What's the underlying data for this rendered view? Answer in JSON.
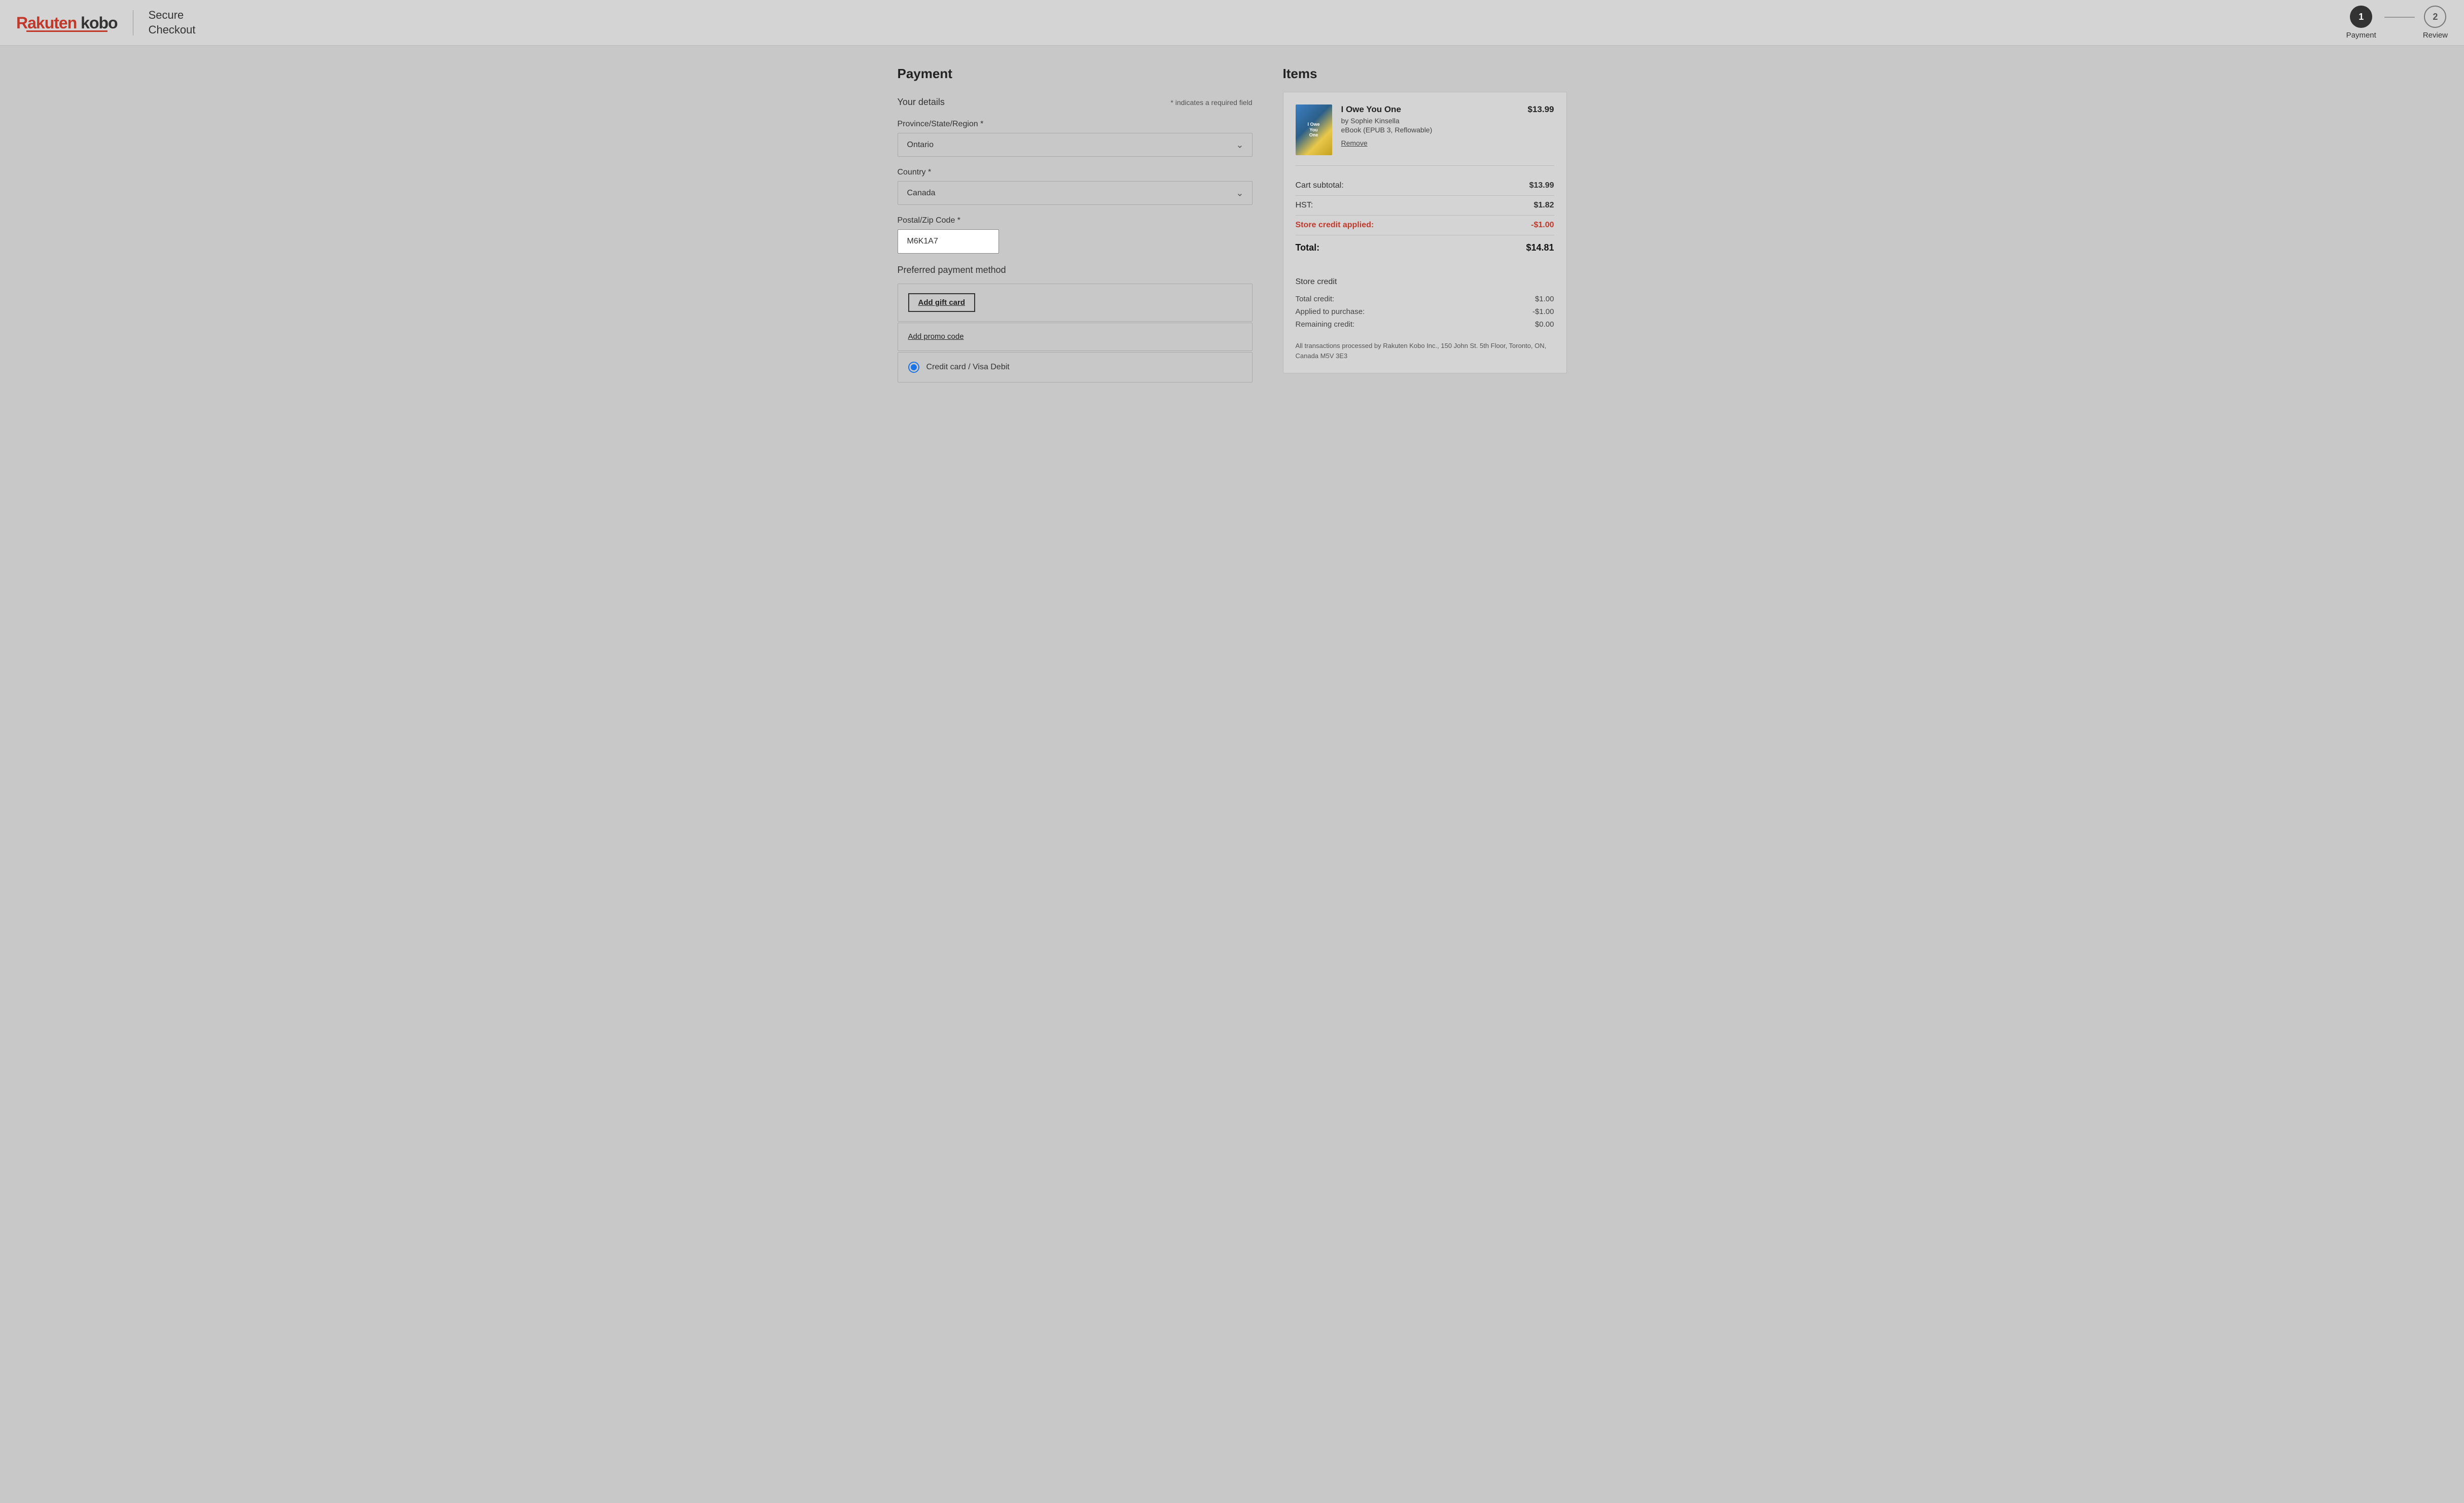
{
  "header": {
    "logo_rakuten": "Rakuten",
    "logo_kobo": " kobo",
    "divider": true,
    "secure_checkout_line1": "Secure",
    "secure_checkout_line2": "Checkout",
    "steps": [
      {
        "number": "1",
        "label": "Payment",
        "active": true
      },
      {
        "number": "2",
        "label": "Review",
        "active": false
      }
    ]
  },
  "payment": {
    "section_title": "Payment",
    "your_details_label": "Your details",
    "required_note": "* indicates a required field",
    "province_label": "Province/State/Region *",
    "province_value": "Ontario",
    "country_label": "Country *",
    "country_value": "Canada",
    "postal_label": "Postal/Zip Code *",
    "postal_value": "M6K1A7",
    "preferred_payment_title": "Preferred payment method",
    "add_gift_card_label": "Add gift card",
    "add_promo_label": "Add promo code",
    "credit_card_label": "Credit card / Visa Debit"
  },
  "items": {
    "section_title": "Items",
    "book": {
      "title": "I Owe You One",
      "author": "by Sophie Kinsella",
      "format": "eBook (EPUB 3, Reflowable)",
      "price": "$13.99",
      "remove_label": "Remove",
      "cover_text": "I Owe You One"
    },
    "cart_subtotal_label": "Cart subtotal:",
    "cart_subtotal_value": "$13.99",
    "hst_label": "HST:",
    "hst_value": "$1.82",
    "store_credit_applied_label": "Store credit applied:",
    "store_credit_applied_value": "-$1.00",
    "total_label": "Total:",
    "total_value": "$14.81",
    "store_credit_section_title": "Store credit",
    "total_credit_label": "Total credit:",
    "total_credit_value": "$1.00",
    "applied_to_purchase_label": "Applied to purchase:",
    "applied_to_purchase_value": "-$1.00",
    "remaining_credit_label": "Remaining credit:",
    "remaining_credit_value": "$0.00",
    "footer_note": "All transactions processed by Rakuten Kobo Inc., 150 John St. 5th Floor, Toronto, ON, Canada M5V 3E3"
  }
}
